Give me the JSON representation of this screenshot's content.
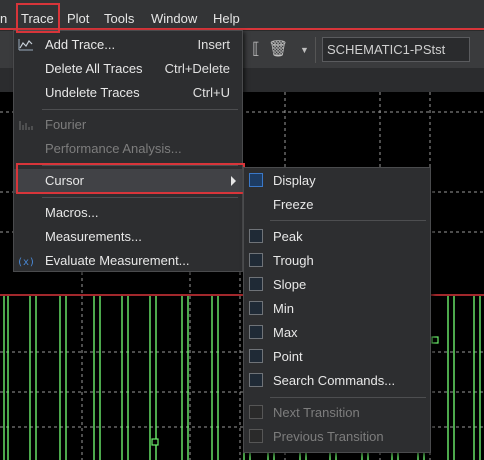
{
  "menubar": {
    "items": [
      "n",
      "Trace",
      "Plot",
      "Tools",
      "Window",
      "Help"
    ]
  },
  "toolbar": {
    "schematic_field": "SCHEMATIC1-PStst"
  },
  "trace_menu": {
    "add_trace": {
      "label": "Add Trace...",
      "shortcut": "Insert"
    },
    "delete_all": {
      "label": "Delete All Traces",
      "shortcut": "Ctrl+Delete"
    },
    "undelete": {
      "label": "Undelete Traces",
      "shortcut": "Ctrl+U"
    },
    "fourier": {
      "label": "Fourier"
    },
    "performance": {
      "label": "Performance Analysis..."
    },
    "cursor": {
      "label": "Cursor"
    },
    "macros": {
      "label": "Macros..."
    },
    "measurements": {
      "label": "Measurements..."
    },
    "evaluate": {
      "label": "Evaluate Measurement..."
    }
  },
  "cursor_menu": {
    "display": "Display",
    "freeze": "Freeze",
    "peak": "Peak",
    "trough": "Trough",
    "slope": "Slope",
    "min": "Min",
    "max": "Max",
    "point": "Point",
    "search": "Search Commands...",
    "next_transition": "Next Transition",
    "previous_transition": "Previous Transition"
  },
  "colors": {
    "highlight": "#d8353a",
    "trace": "#6cf06c",
    "grid": "#9a9a9a"
  }
}
